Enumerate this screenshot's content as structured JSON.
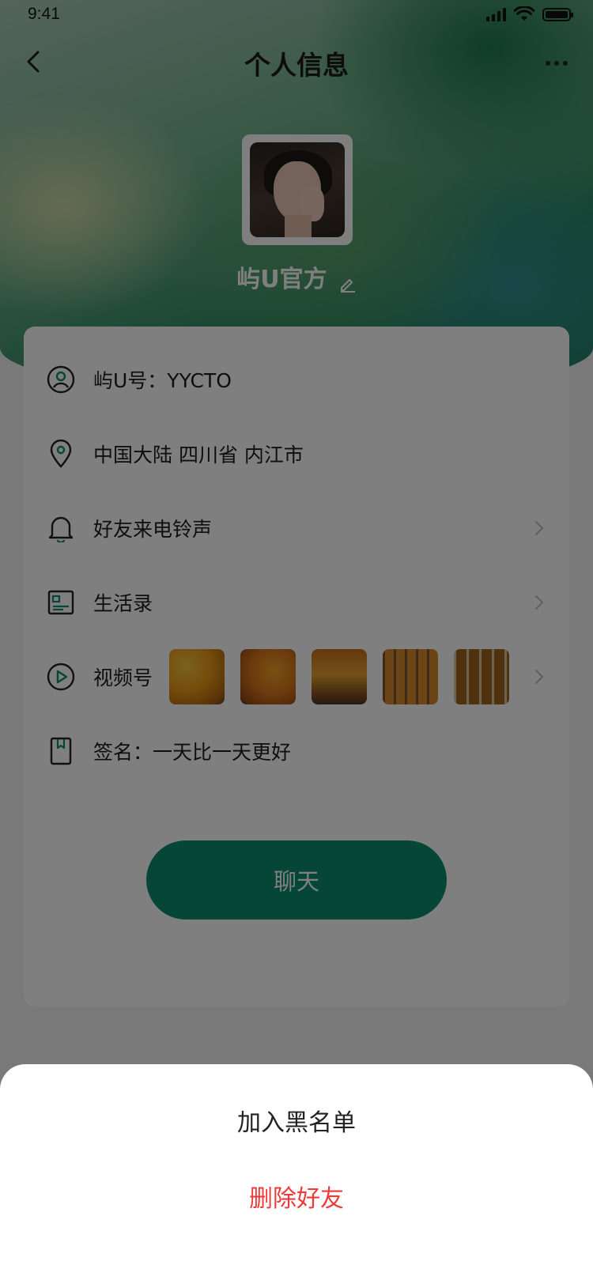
{
  "status_bar": {
    "time": "9:41"
  },
  "header": {
    "title": "个人信息"
  },
  "profile": {
    "name": "屿U官方"
  },
  "info": {
    "id_text": "屿U号：YYCTO",
    "location_text": "中国大陆  四川省  内江市",
    "ringtone_label": "好友来电铃声",
    "life_label": "生活录",
    "video_label": "视频号",
    "signature_text": "签名：一天比一天更好"
  },
  "video_thumbnails": [
    "autumn-forest-1",
    "autumn-forest-2",
    "autumn-forest-3",
    "autumn-forest-4",
    "autumn-forest-5"
  ],
  "chat_button": {
    "label": "聊天"
  },
  "action_sheet": {
    "blacklist_label": "加入黑名单",
    "delete_label": "删除好友"
  },
  "colors": {
    "accent": "#0a8c6c",
    "danger": "#ef3a3a",
    "overlay": "rgba(0,0,0,0.5)"
  }
}
